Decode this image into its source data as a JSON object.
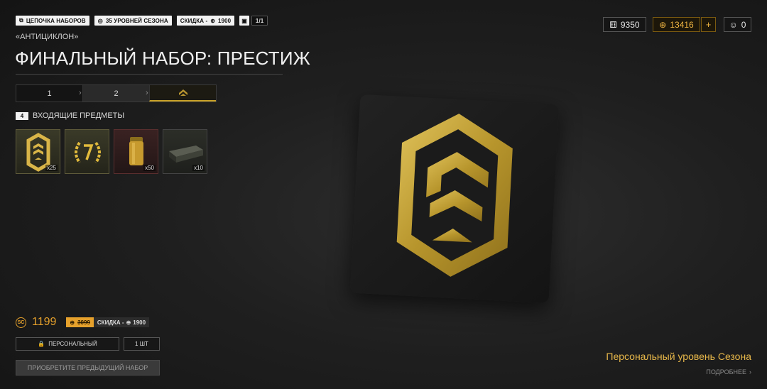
{
  "tags": {
    "chain": "ЦЕПОЧКА НАБОРОВ",
    "levels": "35 УРОВНЕЙ СЕЗОНА",
    "discount": "СКИДКА -",
    "discount_value": "1900",
    "counter": "1/1"
  },
  "subtitle": "«АНТИЦИКЛОН»",
  "title": "ФИНАЛЬНЫЙ НАБОР: ПРЕСТИЖ",
  "steps": [
    "1",
    "2"
  ],
  "included": {
    "count": "4",
    "label": "ВХОДЯЩИЕ ПРЕДМЕТЫ"
  },
  "items": [
    {
      "icon": "prestige-emblem-icon",
      "qty": "x25"
    },
    {
      "icon": "level-7-wreath-icon",
      "qty": ""
    },
    {
      "icon": "gold-capsule-icon",
      "qty": "x50"
    },
    {
      "icon": "ammo-box-icon",
      "qty": "x10"
    }
  ],
  "currencies": {
    "tokens": "9350",
    "gold": "13416",
    "plus": "+",
    "other": "0"
  },
  "price": {
    "value": "1199",
    "old": "3099",
    "discount": "СКИДКА -",
    "discount_value": "1900",
    "currency_mark": "SC"
  },
  "personal": "ПЕРСОНАЛЬНЫЙ",
  "qty": "1 ШТ",
  "buy": "ПРИОБРЕТИТЕ ПРЕДЫДУЩИЙ НАБОР",
  "product_name": "Персональный уровень Сезона",
  "more": "ПОДРОБНЕЕ",
  "colors": {
    "accent": "#e6a12c",
    "gold_text": "#e8b84a",
    "emblem": "#c9a83a"
  }
}
